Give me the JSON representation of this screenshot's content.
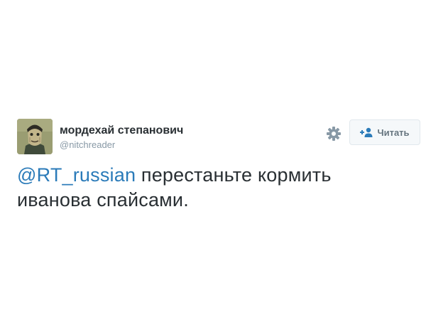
{
  "user": {
    "display_name": "мордехай степанович",
    "handle": "@nitchreader"
  },
  "actions": {
    "settings_icon": "gear-icon",
    "follow_icon": "add-user-icon",
    "follow_label": "Читать"
  },
  "tweet": {
    "mention": "@RT_russian",
    "text_line1": " перестаньте кормить",
    "text_line2": "иванова спайсами."
  },
  "colors": {
    "link": "#2b7bb9",
    "text": "#292f33",
    "muted": "#8899a6"
  }
}
